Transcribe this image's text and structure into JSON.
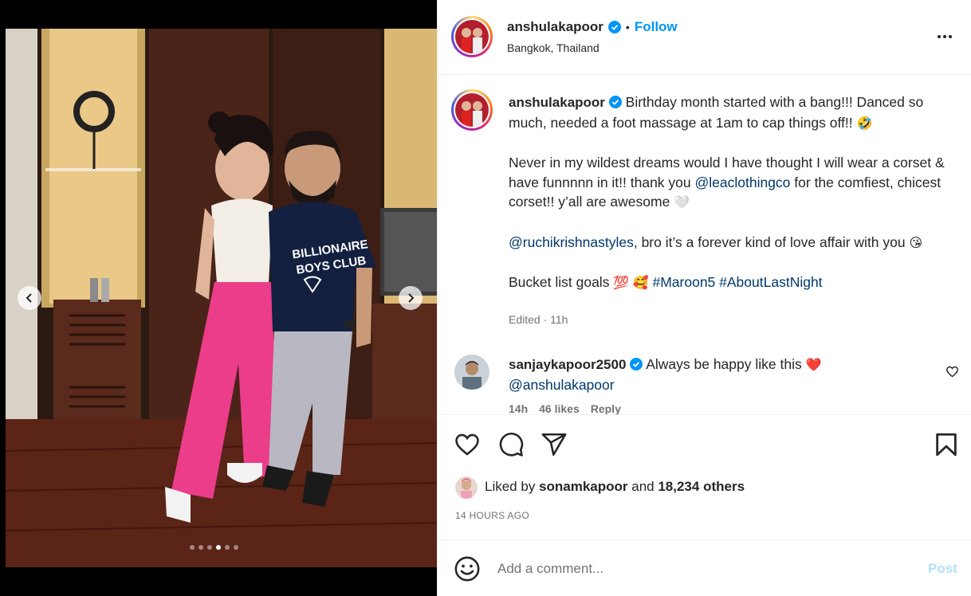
{
  "post": {
    "username": "anshulakapoor",
    "follow_label": "Follow",
    "bullet": "•",
    "location": "Bangkok, Thailand"
  },
  "caption": {
    "username": "anshulakapoor",
    "line1": "Birthday month started with a bang!!! Danced so much, needed a foot massage at 1am to cap things off!! ",
    "line1_emoji": "🤣",
    "p2_a": "Never in my wildest dreams would I have thought I will wear a corset & have funnnnn in it!! thank you ",
    "p2_link": "@leaclothingco",
    "p2_b": " for the comfiest, chicest corset!! y’all are awesome ",
    "p2_emoji": "🤍",
    "p3_link": "@ruchikrishnastyles",
    "p3_b": ", bro it’s a forever kind of love affair with you ",
    "p3_emoji": "😘",
    "p4_a": "Bucket list goals ",
    "p4_emoji": "💯 🥰",
    "p4_tags": "#Maroon5 #AboutLastNight",
    "meta": "Edited · 11h"
  },
  "comment": {
    "username": "sanjaykapoor2500",
    "text": "Always be happy like this ",
    "emoji": "❤️",
    "mention": "@anshulakapoor",
    "time": "14h",
    "likes": "46 likes",
    "reply": "Reply"
  },
  "likes": {
    "prefix": "Liked by ",
    "user": "sonamkapoor",
    "middle": " and ",
    "others": "18,234 others"
  },
  "timestamp": "14 HOURS AGO",
  "add_comment": {
    "placeholder": "Add a comment...",
    "post_label": "Post"
  },
  "carousel": {
    "slide_count": 6,
    "active_index": 3
  },
  "colors": {
    "link": "#0095f6",
    "mention": "#00376b",
    "muted": "#737373"
  },
  "icons": [
    "more-options-icon",
    "verified-icon",
    "heart-icon",
    "comment-icon",
    "share-icon",
    "save-icon",
    "emoji-icon",
    "chevron-left-icon",
    "chevron-right-icon"
  ]
}
